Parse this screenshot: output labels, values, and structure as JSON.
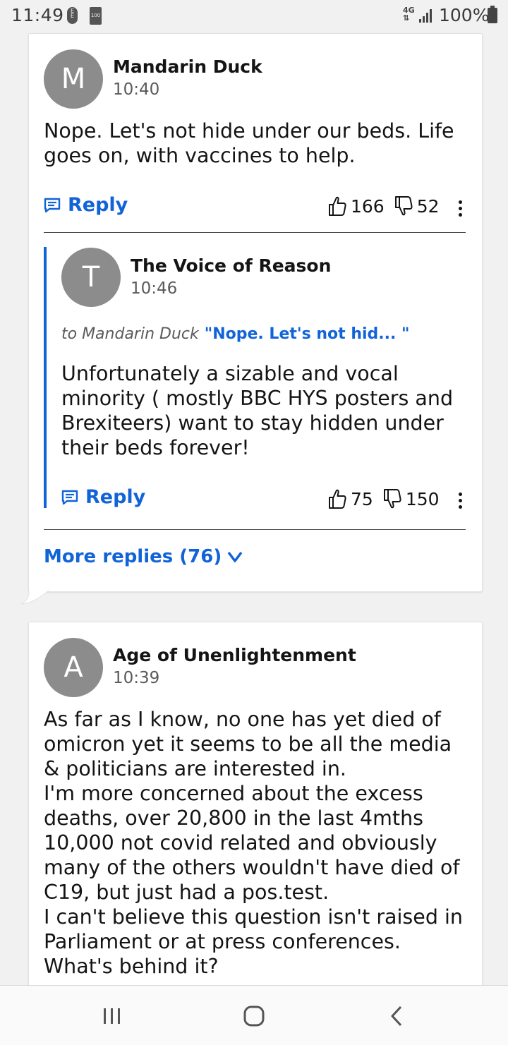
{
  "status_bar": {
    "time": "11:49",
    "carrier_icon": "ee-icon",
    "small_battery_label": "100",
    "network": "4G",
    "battery_pct": "100%"
  },
  "comments": [
    {
      "avatar_letter": "M",
      "author": "Mandarin Duck",
      "time": "10:40",
      "body": "Nope. Let's not hide under our beds. Life goes on, with vaccines to help.",
      "reply_label": "Reply",
      "likes": "166",
      "dislikes": "52",
      "replies": [
        {
          "avatar_letter": "T",
          "author": "The Voice of Reason",
          "time": "10:46",
          "to_label": "to Mandarin Duck",
          "quote": "\"Nope. Let's not hid... \"",
          "body": "Unfortunately a sizable and vocal minority ( mostly BBC HYS posters and Brexiteers) want to stay hidden under their beds forever!",
          "reply_label": "Reply",
          "likes": "75",
          "dislikes": "150"
        }
      ],
      "more_replies_label": "More replies (76)"
    },
    {
      "avatar_letter": "A",
      "author": "Age of Unenlightenment",
      "time": "10:39",
      "body_lines": [
        "As far as I know, no one has yet died of omicron yet it seems to be all the media & politicians are interested in.",
        "I'm more concerned about the excess deaths, over 20,800 in the last 4mths 10,000 not covid related and obviously many of the others wouldn't have died of C19, but just had a pos.test.",
        "I can't believe this question isn't raised in Parliament or at press conferences.",
        "What's behind it?"
      ]
    }
  ],
  "colors": {
    "accent_blue": "#1163d8",
    "avatar_grey": "#8c8c8c",
    "background": "#f1f1f1"
  }
}
